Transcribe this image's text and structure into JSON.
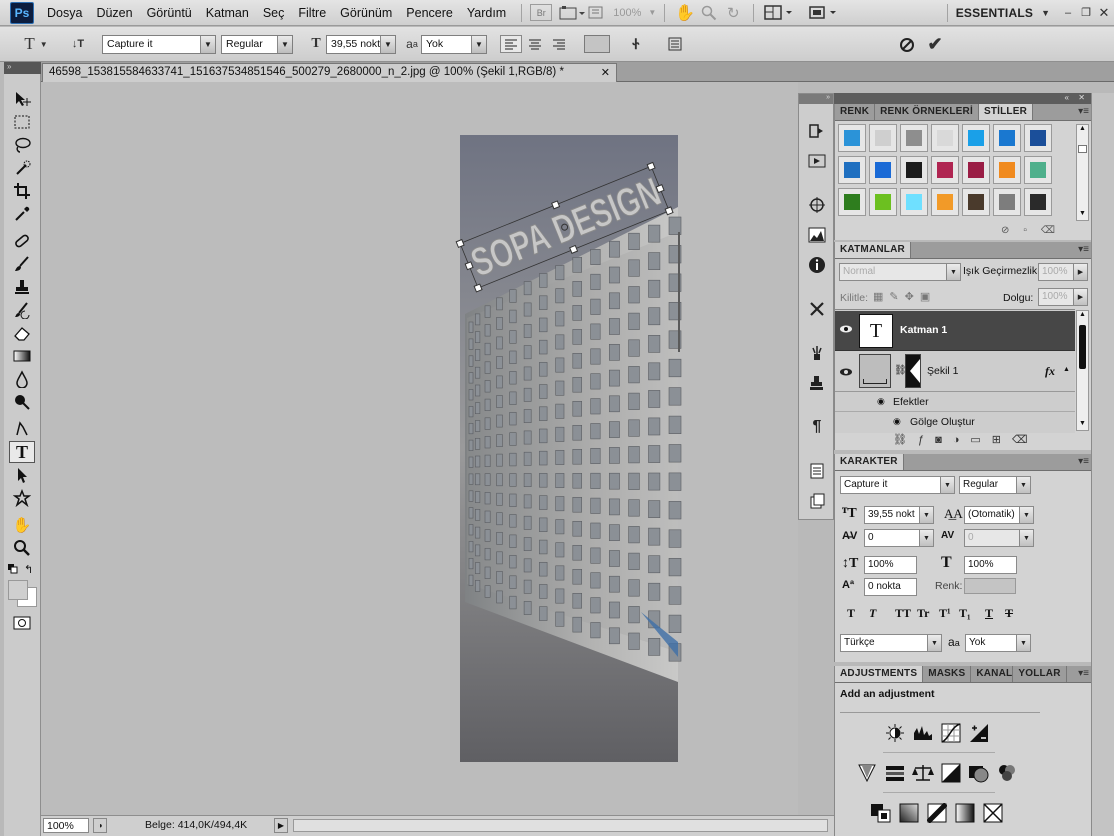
{
  "app": {
    "logo": "Ps"
  },
  "menu": [
    "Dosya",
    "Düzen",
    "Görüntü",
    "Katman",
    "Seç",
    "Filtre",
    "Görünüm",
    "Pencere",
    "Yardım"
  ],
  "appbar": {
    "bridge": "Br",
    "zoom": "100%",
    "workspace": "ESSENTIALS"
  },
  "options": {
    "font_family": "Capture it",
    "font_style": "Regular",
    "font_size": "39,55 nokt",
    "antialias_icon": "a",
    "antialias_sub": "a",
    "antialias": "Yok"
  },
  "document": {
    "tab_title": "46598_153815584633741_151637534851546_500279_2680000_n_2.jpg @ 100% (Şekil 1,RGB/8) *",
    "canvas_text": "SOPA DESIGN"
  },
  "status": {
    "zoom": "100%",
    "doc_info": "Belge: 414,0K/494,4K"
  },
  "styles_panel": {
    "tabs": [
      "RENK",
      "RENK ÖRNEKLERİ",
      "STİLLER"
    ],
    "active_tab": "STİLLER"
  },
  "layers_panel": {
    "title": "KATMANLAR",
    "blend_mode": "Normal",
    "opacity_label": "Işık Geçirmezlik:",
    "opacity": "100%",
    "lock_label": "Kilitle:",
    "fill_label": "Dolgu:",
    "fill": "100%",
    "layers": [
      {
        "name": "Katman 1",
        "thumb": "T"
      },
      {
        "name": "Şekil 1",
        "fx": "fx"
      }
    ],
    "effects_label": "Efektler",
    "effect_items": [
      "Gölge Oluştur"
    ]
  },
  "character_panel": {
    "title": "KARAKTER",
    "font_family": "Capture it",
    "font_style": "Regular",
    "size": "39,55 nokt",
    "leading": "(Otomatik)",
    "kerning": "0",
    "tracking": "0",
    "vscale": "100%",
    "hscale": "100%",
    "baseline": "0 nokta",
    "color_label": "Renk:",
    "style_buttons": [
      "T",
      "T",
      "TT",
      "Tr",
      "T¹",
      "T₁",
      "T",
      "T"
    ],
    "language": "Türkçe",
    "antialias_icon": "a",
    "antialias_sub": "a",
    "antialias": "Yok"
  },
  "adjustments_panel": {
    "tabs": [
      "ADJUSTMENTS",
      "MASKS",
      "KANALLAR",
      "YOLLAR"
    ],
    "heading": "Add an adjustment"
  },
  "colors": {
    "swatches": [
      "#2b93d8",
      "#cfcfcf",
      "#8e8e8e",
      "#d9d9d9",
      "#1aa0e8",
      "#1a78d0",
      "#1b4f9a",
      "#1f6fc0",
      "#1a6ad6",
      "#1c1c1c",
      "#b02652",
      "#9a1d45",
      "#f08a1e",
      "#4fb08c",
      "#2e7d1e",
      "#6cc020",
      "#6fe0ff",
      "#f29a28",
      "#4a3a2c",
      "#7d7d7d",
      "#2a2a2a"
    ]
  }
}
